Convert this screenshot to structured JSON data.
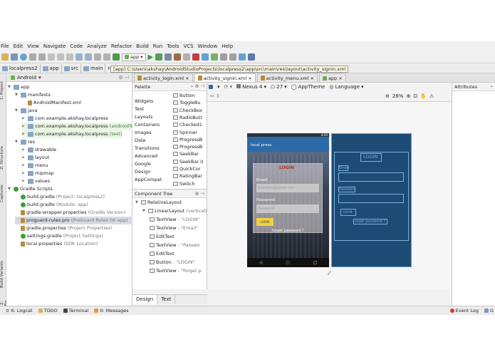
{
  "menu": [
    "File",
    "Edit",
    "View",
    "Navigate",
    "Code",
    "Analyze",
    "Refactor",
    "Build",
    "Run",
    "Tools",
    "VCS",
    "Window",
    "Help"
  ],
  "toolbar": {
    "run_config": "app"
  },
  "nav": {
    "crumbs": [
      "localpress2",
      "app",
      "src",
      "main",
      "re"
    ],
    "tooltip": "[app] C:\\Users\\akshay\\AndroidStudioProjects\\localpress2\\app\\src\\main\\res\\layout\\activity_signin.xml"
  },
  "side_labels": {
    "project": "1: Project",
    "structure": "Z: Structure",
    "captures": "Captures",
    "build_variants": "Build Variants",
    "favorites": "2: Favorites"
  },
  "project": {
    "view_mode": "Android",
    "tree": [
      {
        "label": "app",
        "indent": 0,
        "icon": "folder",
        "arrow": "▼"
      },
      {
        "label": "manifests",
        "indent": 1,
        "icon": "folder",
        "arrow": "▼"
      },
      {
        "label": "AndroidManifest.xml",
        "indent": 2,
        "icon": "file",
        "arrow": ""
      },
      {
        "label": "java",
        "indent": 1,
        "icon": "folder",
        "arrow": "▼"
      },
      {
        "label": "com.example.akshay.localpress",
        "indent": 2,
        "icon": "folder",
        "arrow": "►",
        "note": ""
      },
      {
        "label": "com.example.akshay.localpress",
        "indent": 2,
        "icon": "folder",
        "arrow": "►",
        "note": "(androidTest)"
      },
      {
        "label": "com.example.akshay.localpress",
        "indent": 2,
        "icon": "folder",
        "arrow": "►",
        "note": "(test)"
      },
      {
        "label": "res",
        "indent": 1,
        "icon": "folder",
        "arrow": "▼"
      },
      {
        "label": "drawable",
        "indent": 2,
        "icon": "folder",
        "arrow": "►"
      },
      {
        "label": "layout",
        "indent": 2,
        "icon": "folder",
        "arrow": "►"
      },
      {
        "label": "menu",
        "indent": 2,
        "icon": "folder",
        "arrow": "►"
      },
      {
        "label": "mipmap",
        "indent": 2,
        "icon": "folder",
        "arrow": "►"
      },
      {
        "label": "values",
        "indent": 2,
        "icon": "folder",
        "arrow": "►"
      },
      {
        "label": "Gradle Scripts",
        "indent": 0,
        "icon": "gradle",
        "arrow": "▼"
      },
      {
        "label": "build.gradle",
        "indent": 1,
        "icon": "gradle",
        "arrow": "",
        "note": "(Project: localpress2)"
      },
      {
        "label": "build.gradle",
        "indent": 1,
        "icon": "gradle",
        "arrow": "",
        "note": "(Module: app)"
      },
      {
        "label": "gradle-wrapper.properties",
        "indent": 1,
        "icon": "file",
        "arrow": "",
        "note": "(Gradle Version)"
      },
      {
        "label": "proguard-rules.pro",
        "indent": 1,
        "icon": "file",
        "arrow": "",
        "note": "(ProGuard Rules for app)"
      },
      {
        "label": "gradle.properties",
        "indent": 1,
        "icon": "file",
        "arrow": "",
        "note": "(Project Properties)"
      },
      {
        "label": "settings.gradle",
        "indent": 1,
        "icon": "gradle",
        "arrow": "",
        "note": "(Project Settings)"
      },
      {
        "label": "local.properties",
        "indent": 1,
        "icon": "file",
        "arrow": "",
        "note": "(SDK Location)"
      }
    ]
  },
  "editor_tabs": [
    {
      "label": "activity_login.xml",
      "active": false
    },
    {
      "label": "activity_signin.xml",
      "active": true
    },
    {
      "label": "activity_menu.xml",
      "active": false
    },
    {
      "label": "app",
      "active": false
    }
  ],
  "palette": {
    "title": "Palette",
    "categories": [
      "Widgets",
      "Text",
      "Layouts",
      "Containers",
      "Images",
      "Date",
      "Transitions",
      "Advanced",
      "Google",
      "Design",
      "AppCompat"
    ],
    "items": [
      "Button",
      "ToggleBu",
      "CheckBox",
      "RadioButt",
      "Checked1",
      "Spinner",
      "ProgressB",
      "ProgressB",
      "SeekBar",
      "SeekBar (I",
      "QuickCor",
      "RatingBar",
      "Switch"
    ]
  },
  "component_tree": {
    "title": "Component Tree",
    "nodes": [
      {
        "label": "RelativeLayout",
        "indent": 0,
        "note": ""
      },
      {
        "label": "LinearLayout",
        "indent": 1,
        "note": "(vertical)"
      },
      {
        "label": "TextView",
        "indent": 2,
        "note": "- \"LOGIN\""
      },
      {
        "label": "TextView",
        "indent": 2,
        "note": "- \"Email\""
      },
      {
        "label": "EditText",
        "indent": 2,
        "note": ""
      },
      {
        "label": "TextView",
        "indent": 2,
        "note": "- \"Passwo"
      },
      {
        "label": "EditText",
        "indent": 2,
        "note": ""
      },
      {
        "label": "Button",
        "indent": 2,
        "note": "- \"LOGIN\""
      },
      {
        "label": "TextView",
        "indent": 2,
        "note": "- \"forget p"
      }
    ]
  },
  "design_tabs": [
    "Design",
    "Text"
  ],
  "design_toolbar": {
    "device": "Nexus 4",
    "api": "27",
    "theme": "AppTheme",
    "language": "Language",
    "zoom": "26%"
  },
  "phone": {
    "app_title": "local press",
    "header": "LOGIN",
    "email_label": "Email",
    "email_placeholder": "example@gmail.com",
    "password_label": "Password",
    "password_placeholder": "Password",
    "button": "LOGIN",
    "forgot": "forget password ?",
    "status_time": "8:00"
  },
  "blueprint": {
    "header": "LOGIN",
    "email_label": "Email",
    "password_label": "Password",
    "button": "LOGIN",
    "forgot": "orget password ?"
  },
  "attributes": {
    "title": "Attributes"
  },
  "statusbar": {
    "left": [
      "6: Logcat",
      "TODO",
      "Terminal",
      "0: Messages"
    ],
    "right": [
      "Event Log",
      "G"
    ]
  },
  "colors": {
    "accent": "#2d6aa8",
    "button": "#f4d03f",
    "blueprint": "#1d4b73"
  }
}
